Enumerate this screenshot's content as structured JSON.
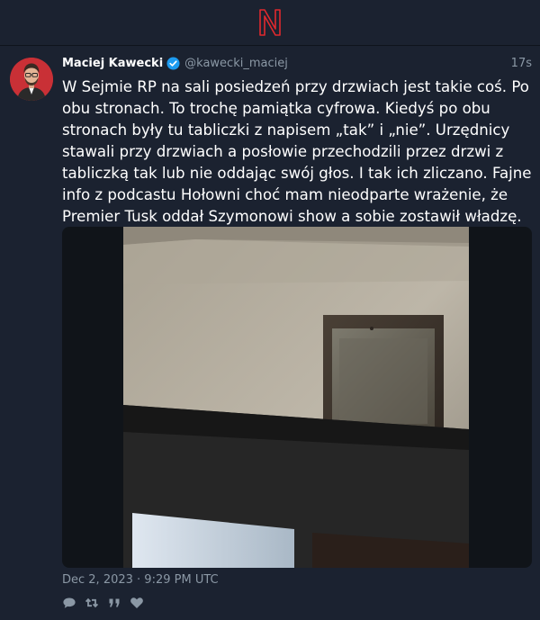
{
  "app": {
    "logo_letter": "N",
    "accent": "#e0292e"
  },
  "tweet": {
    "fullname": "Maciej Kawecki",
    "handle": "@kawecki_maciej",
    "time": "17s",
    "text": "W Sejmie RP na sali posiedzeń przy drzwiach jest takie coś. Po obu stronach. To trochę pamiątka cyfrowa. Kiedyś po obu stronach były tu tabliczki z napisem „tak” i „nie”. Urzędnicy stawali przy drzwiach a posłowie przechodzili przez drzwi z tabliczką tak lub nie oddając swój głos. I tak ich zliczano. Fajne info z podcastu Hołowni choć mam nieodparte wrażenie, że Premier Tusk oddał Szymonowi show a sobie zostawił władzę.",
    "date": "Dec 2, 2023 · 9:29 PM UTC",
    "verified_color": "#1d9bf0"
  },
  "actions": [
    {
      "icon": "comment-icon"
    },
    {
      "icon": "retweet-icon"
    },
    {
      "icon": "quote-icon"
    },
    {
      "icon": "heart-icon"
    }
  ]
}
